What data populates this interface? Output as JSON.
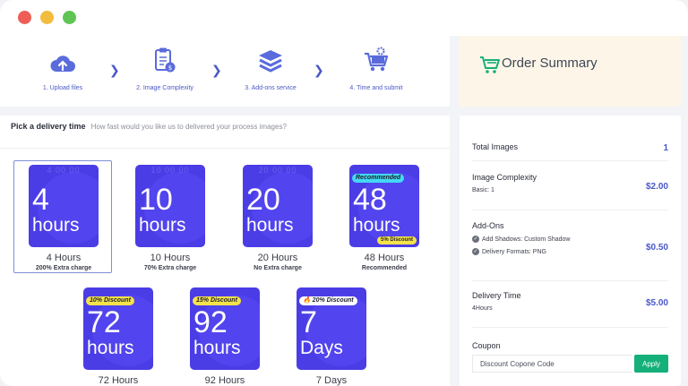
{
  "steps": [
    {
      "label": "1. Upload files",
      "icon": "cloud-upload-icon"
    },
    {
      "label": "2. Image Complexity",
      "icon": "clipboard-dollar-icon"
    },
    {
      "label": "3. Add-ons service",
      "icon": "layers-icon"
    },
    {
      "label": "4. Time and submit",
      "icon": "cart-gear-icon"
    }
  ],
  "order_summary": {
    "title": "Order Summary",
    "icon": "shopping-cart-icon",
    "total_images_label": "Total Images",
    "total_images_value": "1",
    "complexity_label": "Image Complexity",
    "complexity_detail": "Basic: 1",
    "complexity_value": "$2.00",
    "addons_label": "Add-Ons",
    "addon_1": "Add Shadows:  Custom Shadow",
    "addon_2": "Delivery Formats:  PNG",
    "addons_value": "$0.50",
    "delivery_label": "Delivery Time",
    "delivery_detail": "4Hours",
    "delivery_value": "$5.00",
    "coupon_label": "Coupon",
    "coupon_placeholder": "Discount Copone Code",
    "apply_label": "Apply"
  },
  "delivery": {
    "heading": "Pick a delivery time",
    "question": "How fast would you like us to delivered your process images?",
    "options": [
      {
        "num": "4",
        "unit": "hours",
        "title": "4 Hours",
        "sub": "200% Extra charge",
        "ghost": "4 00 00"
      },
      {
        "num": "10",
        "unit": "hours",
        "title": "10 Hours",
        "sub": "70% Extra charge",
        "ghost": "10 00 00"
      },
      {
        "num": "20",
        "unit": "hours",
        "title": "20 Hours",
        "sub": "No Extra charge",
        "ghost": "20 00 00"
      },
      {
        "num": "48",
        "unit": "hours",
        "title": "48 Hours",
        "sub": "Recommended",
        "top_badge": "Recommended",
        "bottom_badge": "5% Discount"
      },
      {
        "num": "72",
        "unit": "hours",
        "title": "72 Hours",
        "top_badge": "10% Discount"
      },
      {
        "num": "92",
        "unit": "hours",
        "title": "92 Hours",
        "top_badge": "15% Discount"
      },
      {
        "num": "7",
        "unit": "Days",
        "title": "7 Days",
        "top_badge": "20% Discount"
      }
    ]
  },
  "colors": {
    "accent": "#4a3de6",
    "link": "#4a58c7",
    "apply": "#15b07a",
    "summary_bg": "#fdf6e8"
  }
}
